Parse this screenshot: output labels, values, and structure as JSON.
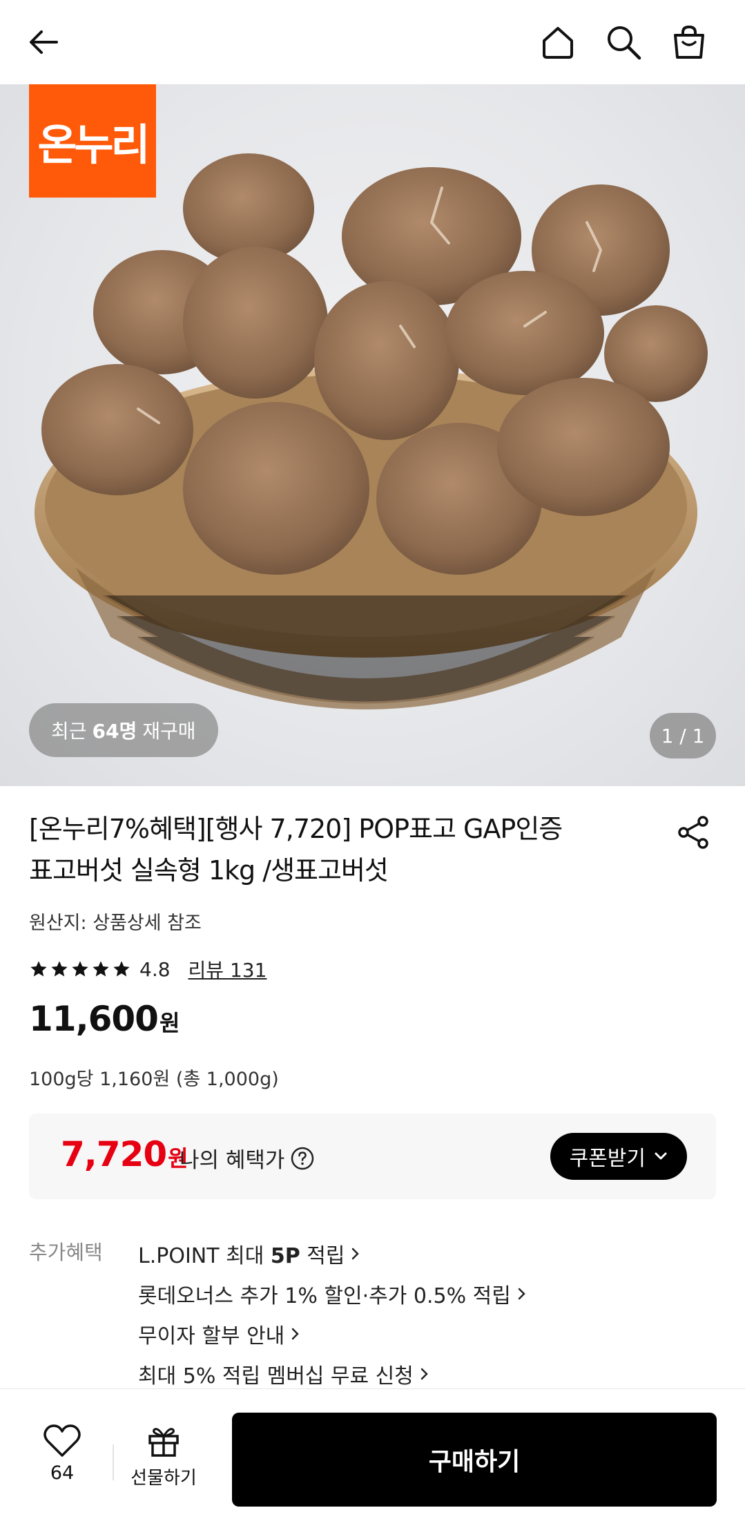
{
  "header": {
    "back_icon": "arrow-left-icon",
    "home_icon": "home-icon",
    "search_icon": "search-icon",
    "cart_icon": "shopping-bag-icon"
  },
  "hero": {
    "brand_badge": "온누리",
    "rebuy_prefix": "최근",
    "rebuy_count": "64명",
    "rebuy_suffix": "재구매",
    "counter": "1 / 1"
  },
  "product": {
    "title_line1": "[온누리7%혜택][행사 7,720] POP표고 GAP인증",
    "title_line2": "표고버섯 실속형 1kg /생표고버섯",
    "origin": "원산지: 상품상세 참조",
    "rating_value": "4.8",
    "rating_stars": 4.8,
    "review_link": "리뷰 131",
    "price": "11,600",
    "price_unit": "원",
    "unit_price": "100g당 1,160원 (총 1,000g)"
  },
  "benefit": {
    "price": "7,720",
    "price_unit": "원",
    "label": "나의 혜택가",
    "coupon_button": "쿠폰받기"
  },
  "extra": {
    "label": "추가혜택",
    "items": [
      {
        "pre": "L.POINT 최대 ",
        "bold": "5P",
        "post": " 적립"
      },
      {
        "pre": "롯데오너스 추가 1% 할인·추가 0.5% 적립",
        "bold": "",
        "post": ""
      },
      {
        "pre": "무이자 할부 안내",
        "bold": "",
        "post": ""
      },
      {
        "pre": "최대 5% 적립 멤버십 무료 신청",
        "bold": "",
        "post": ""
      }
    ]
  },
  "bottom": {
    "like_count": "64",
    "gift_label": "선물하기",
    "buy_label": "구매하기"
  },
  "colors": {
    "brand_orange": "#ff5a0a",
    "benefit_red": "#e60012"
  }
}
